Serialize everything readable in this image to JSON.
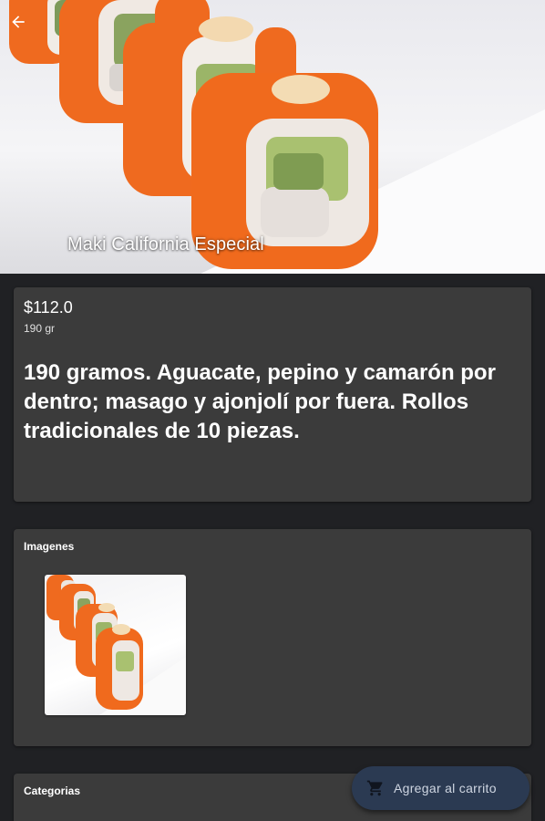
{
  "product": {
    "title": "Maki California Especial",
    "price": "$112.0",
    "weight": "190 gr",
    "description": "190 gramos. Aguacate, pepino y camarón por dentro; masago y ajonjolí por fuera. Rollos tradicionales de 10 piezas."
  },
  "sections": {
    "images_title": "Imagenes",
    "categories_title": "Categorias"
  },
  "actions": {
    "add_to_cart": "Agregar al carrito"
  },
  "icons": {
    "back": "arrow-back-icon",
    "cart": "shopping-cart-icon"
  },
  "colors": {
    "background": "#202124",
    "card": "#3b3b3b",
    "fab": "#2b3a52",
    "accent_orange": "#f26a1b"
  }
}
